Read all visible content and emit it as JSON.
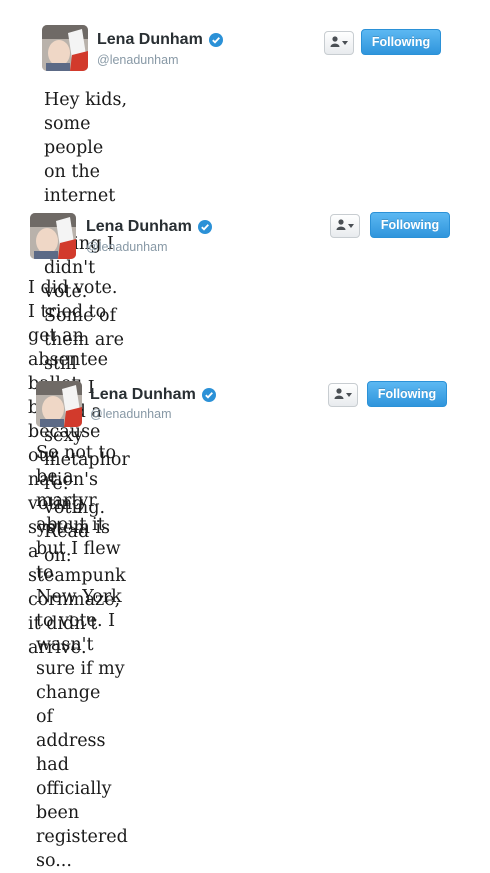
{
  "tweets": [
    {
      "name": "Lena Dunham",
      "handle": "@lenadunham",
      "follow_label": "Following",
      "text": "Hey kids, some people on the internet are\nsaying I didn't vote. Some of them are still\nmad I used a sexy metaphor re: voting. Read\non:"
    },
    {
      "name": "Lena Dunham",
      "handle": "@lenadunham",
      "follow_label": "Following",
      "text": "I did vote. I tried to get an absentee ballot\nbut, because our nation's voting system is a\nsteampunk cornmaze, it didn't arrive."
    },
    {
      "name": "Lena Dunham",
      "handle": "@lenadunham",
      "follow_label": "Following",
      "text": "So not to be a martyr about it but I flew to\nNew York to vote. I wasn't sure if my change\nof address had officially been registered so..."
    }
  ],
  "icons": {
    "verified": "verified-badge-icon",
    "user_dropdown": "user-icon"
  },
  "colors": {
    "follow_button": "#2f95dc",
    "verified": "#2b91d7",
    "handle": "#8899a6"
  }
}
